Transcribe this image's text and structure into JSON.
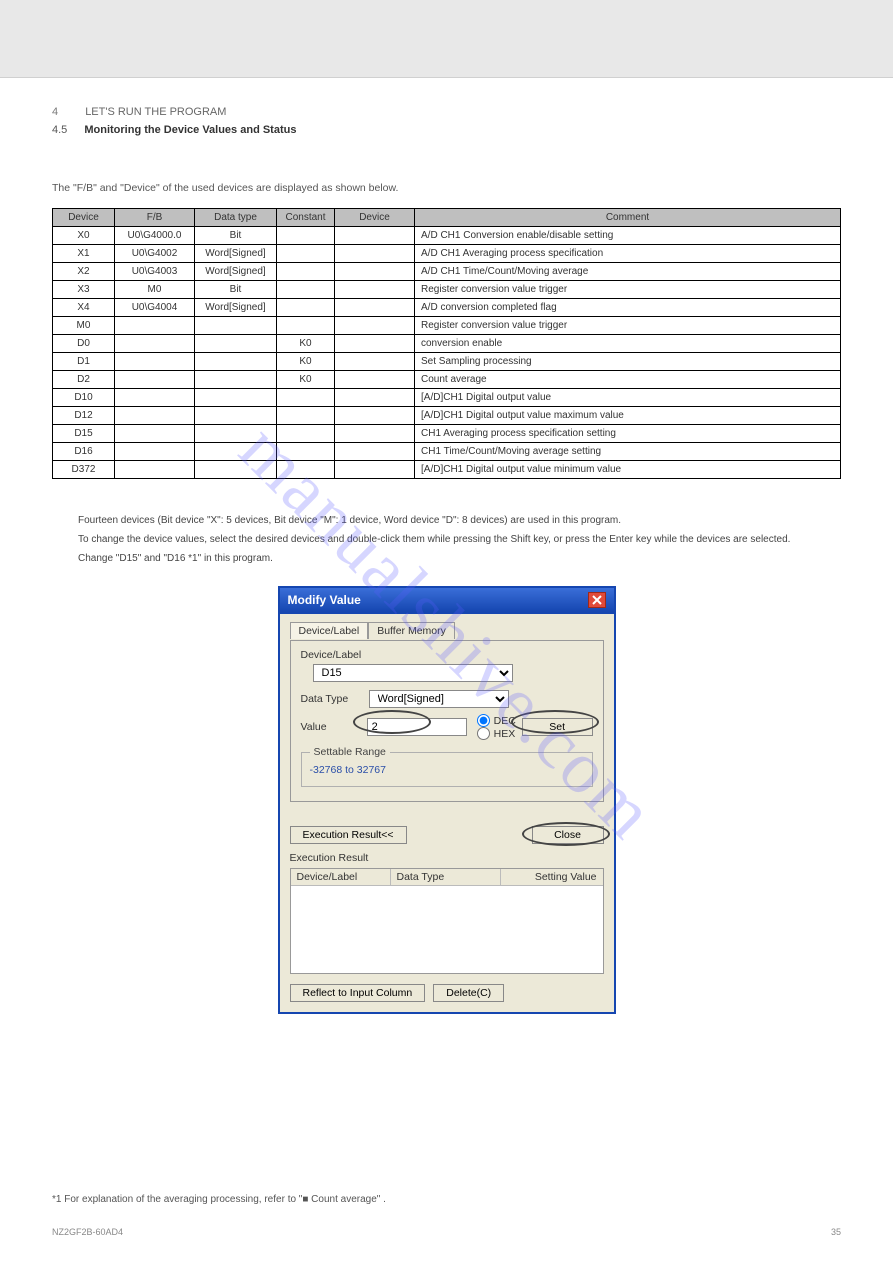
{
  "header": {
    "section_num": "4",
    "section_title": "LET'S RUN THE PROGRAM",
    "sub_num": "4.5",
    "sub_title": "Monitoring the Device Values and Status"
  },
  "intro_line": "The \"F/B\" and \"Device\" of the used devices are displayed as shown below.",
  "table": {
    "headers": [
      "Device",
      "F/B",
      "Data type",
      "Constant",
      "Device",
      "Comment"
    ],
    "rows": [
      [
        "X0",
        "U0\\G4000.0",
        "Bit",
        "",
        "",
        "A/D CH1 Conversion enable/disable setting"
      ],
      [
        "X1",
        "U0\\G4002",
        "Word[Signed]",
        "",
        "",
        "A/D CH1 Averaging process specification"
      ],
      [
        "X2",
        "U0\\G4003",
        "Word[Signed]",
        "",
        "",
        "A/D CH1 Time/Count/Moving average"
      ],
      [
        "X3",
        "M0",
        "Bit",
        "",
        "",
        "Register conversion value trigger"
      ],
      [
        "X4",
        "U0\\G4004",
        "Word[Signed]",
        "",
        "",
        "A/D conversion completed flag"
      ],
      [
        "M0",
        "",
        "",
        "",
        "",
        "Register conversion value trigger"
      ],
      [
        "D0",
        "",
        "",
        "K0",
        "",
        "conversion enable"
      ],
      [
        "D1",
        "",
        "",
        "K0",
        "",
        "Set Sampling processing"
      ],
      [
        "D2",
        "",
        "",
        "K0",
        "",
        "Count average"
      ],
      [
        "D10",
        "",
        "",
        "",
        "",
        "[A/D]CH1 Digital output value"
      ],
      [
        "D12",
        "",
        "",
        "",
        "",
        "[A/D]CH1 Digital output value maximum value"
      ],
      [
        "D15",
        "",
        "",
        "",
        "",
        "CH1 Averaging process specification setting"
      ],
      [
        "D16",
        "",
        "",
        "",
        "",
        "CH1 Time/Count/Moving average setting"
      ],
      [
        "D372",
        "",
        "",
        "",
        "",
        "[A/D]CH1 Digital output value minimum value"
      ]
    ]
  },
  "indent": {
    "line1": "Fourteen devices (Bit device \"X\": 5 devices, Bit device \"M\": 1 device, Word device \"D\": 8 devices) are used in this program.",
    "line2": "To change the device values, select the desired devices and double-click them while pressing the Shift key, or press the Enter key while the devices are selected.",
    "line3": "Change \"D15\" and \"D16 *1\" in this program."
  },
  "dialog": {
    "title": "Modify Value",
    "tabs": {
      "active": "Device/Label",
      "inactive": "Buffer Memory"
    },
    "device_label": "Device/Label",
    "device_value": "D15",
    "data_type_label": "Data Type",
    "data_type_value": "Word[Signed]",
    "value_label": "Value",
    "value_value": "2",
    "radio_dec": "DEC",
    "radio_hex": "HEX",
    "set_button": "Set",
    "range_legend": "Settable Range",
    "range_text": "-32768 to 32767",
    "exec_result_btn": "Execution Result<<",
    "close_btn": "Close",
    "exec_result_label": "Execution Result",
    "grid_headers": [
      "Device/Label",
      "Data Type",
      "Setting Value"
    ],
    "reflect_btn": "Reflect to Input Column",
    "delete_btn": "Delete(C)"
  },
  "footnote": "*1   For explanation of the averaging processing, refer to \"■ Count average\" .",
  "footer": {
    "left": "NZ2GF2B-60AD4",
    "right": "35"
  },
  "watermark": "manualshive.com"
}
